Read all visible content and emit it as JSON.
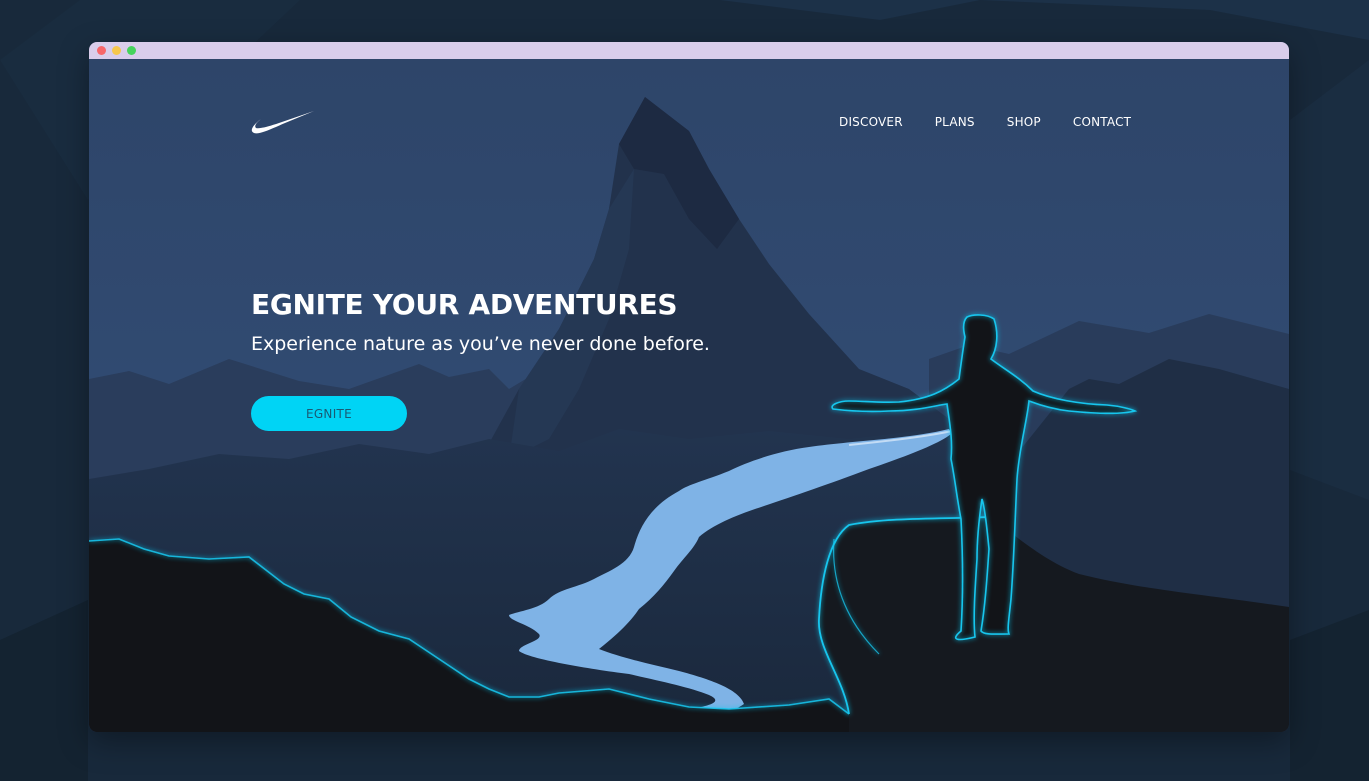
{
  "header": {
    "logo": "swoosh-logo",
    "nav": [
      "DISCOVER",
      "PLANS",
      "SHOP",
      "CONTACT"
    ]
  },
  "hero": {
    "title": "EGNITE YOUR ADVENTURES",
    "subtitle": "Experience nature as you’ve never done before.",
    "cta_label": "EGNITE"
  },
  "colors": {
    "titlebar": "#d9cdeb",
    "sky": "#2f476d",
    "accent": "#00d4f5",
    "glow": "#10c8f0",
    "river": "#7fb3e6"
  }
}
